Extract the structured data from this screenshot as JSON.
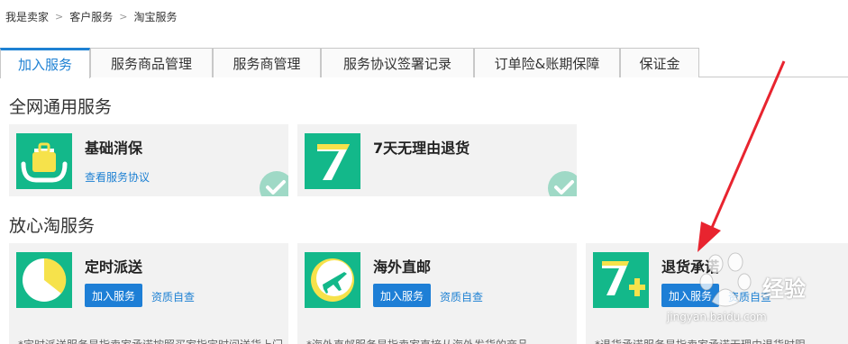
{
  "breadcrumb": [
    "我是卖家",
    "客户服务",
    "淘宝服务"
  ],
  "tabs": [
    "加入服务",
    "服务商品管理",
    "服务商管理",
    "服务协议签署记录",
    "订单险&账期保障",
    "保证金"
  ],
  "sections": {
    "general": "全网通用服务",
    "trusted": "放心淘服务"
  },
  "cards": {
    "c1": {
      "title": "基础消保",
      "link": "查看服务协议",
      "check_icon": "check-icon"
    },
    "c2": {
      "title": "7天无理由退货",
      "logo_text": "7",
      "check_icon": "check-icon"
    },
    "c3": {
      "title": "定时派送",
      "button": "加入服务",
      "link": "资质自查",
      "desc": "*定时派送服务是指卖家承诺按照买家指定时间送货上门"
    },
    "c4": {
      "title": "海外直邮",
      "button": "加入服务",
      "link": "资质自查",
      "desc": "*海外直邮服务是指卖家直接从海外发货的商品"
    },
    "c5": {
      "title": "退货承诺",
      "button": "加入服务",
      "link": "资质自查",
      "logo_text": "7+",
      "desc": "*退货承诺服务是指卖家承诺无理由退货时限"
    }
  },
  "watermark": {
    "brand": "经验",
    "url": "jingyan.baidu.com"
  },
  "colors": {
    "accent": "#1e81d3",
    "logo_green": "#13b88a",
    "logo_yellow": "#f6e24b",
    "arrow": "#e8242f"
  }
}
